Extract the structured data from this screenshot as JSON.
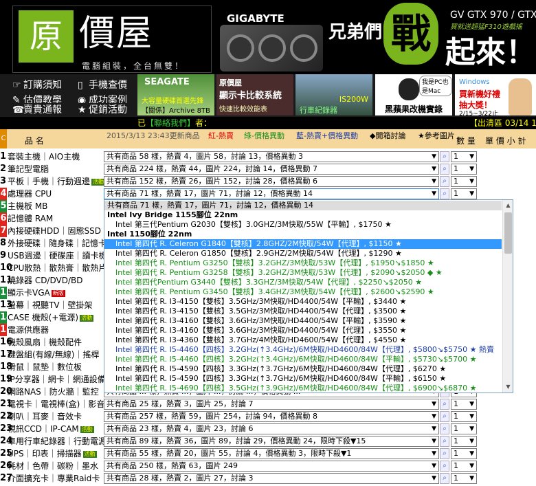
{
  "header": {
    "logo_char": "原",
    "logo_title": "價屋",
    "logo_slogan": "電腦組裝，全台無雙！",
    "ad": {
      "brand": "GIGABYTE",
      "slogan1": "兄弟們，",
      "slogan_war": "戰",
      "slogan2": "起來！",
      "product": "GV GTX 970 / GTX 9",
      "note": "買就送超猛F310遊戲搖"
    }
  },
  "nav": {
    "order_notice": "訂購須知",
    "mobile_lookup": "手機查價",
    "estimate_guide": "估價教學",
    "success_cases": "成功案例",
    "report": "賣貴通報",
    "promotions": "促銷活動"
  },
  "banners": {
    "seagate": {
      "brand": "SEAGATE",
      "line2": "大容量硬碟首選先鋒",
      "line3": "【關係】Archive 8TB HDD"
    },
    "compare": {
      "line1": "原價屋",
      "line2": "顯示卡比較系統",
      "line3": "快速比較效能表"
    },
    "dashcam": {
      "line1": "IS200W",
      "line2": "行車紀錄器"
    },
    "mac": {
      "line1": "我是PC也是Mac",
      "line2": "黑蘋果改機實錄"
    },
    "windows": {
      "line1": "Windows",
      "line2": "買新機好禮",
      "line3": "抽大獎！",
      "line4": "2/15~3/22止"
    }
  },
  "strip": {
    "prefix": "已",
    "link": "【聯絡我們】",
    "suffix": "者：",
    "promo": "【出清區 03/14 13"
  },
  "table_header": {
    "c": "C",
    "name": "品 名",
    "timestamp": "2015/3/13 23:43更新商品",
    "legend_hot": "紅-熱賣",
    "legend_change": "綠-價格異動",
    "legend_blue": "藍-熱賣+價格異動",
    "legend_open": "◆開箱討論",
    "legend_ref": "★參考圖片",
    "qty": "數 量",
    "price": "單 價 小 計"
  },
  "rows": [
    {
      "num": "1",
      "cat": "套裝主機｜AIO主機",
      "summary": "共有商品 58 樣，熱賣 4，圖片 58，討論 13，價格異動 3",
      "qty": "1"
    },
    {
      "num": "2",
      "cat": "筆記型電腦",
      "summary": "共有商品 224 樣，熱賣 44，圖片 224，討論 14，價格異動 7",
      "qty": "1"
    },
    {
      "num": "3",
      "cat": "平板｜手機｜行動週邊",
      "badge": "活動",
      "summary": "共有商品 152 樣，熱賣 26，圖片 152，討論 28，價格異動 6",
      "qty": "1"
    },
    {
      "num": "4",
      "cat": "處理器 CPU",
      "summary": "共有商品 71 樣，熱賣 17，圖片 71，討論 12，價格異動 14",
      "qty": "1"
    },
    {
      "num": "5",
      "cat": "主機板 MB",
      "summary": "",
      "qty": ""
    },
    {
      "num": "6",
      "cat": "記憶體 RAM",
      "summary": "",
      "qty": ""
    },
    {
      "num": "7",
      "cat": "內接硬碟HDD｜固態SSD",
      "summary": "",
      "qty": ""
    },
    {
      "num": "8",
      "cat": "外接硬碟｜隨身碟｜記憶卡",
      "summary": "",
      "qty": ""
    },
    {
      "num": "9",
      "cat": "USB週邊｜硬碟座｜讀卡機",
      "summary": "",
      "qty": ""
    },
    {
      "num": "10",
      "cat": "CPU散熱｜散熱膏｜散熱片",
      "summary": "",
      "qty": ""
    },
    {
      "num": "11",
      "cat": "燒錄器 CD/DVD/BD",
      "summary": "",
      "qty": ""
    },
    {
      "num": "12",
      "cat": "顯示卡VGA",
      "badge_new": "新版",
      "summary": "",
      "qty": ""
    },
    {
      "num": "13",
      "cat": "螢幕｜視聽TV｜壁掛架",
      "summary": "",
      "qty": ""
    },
    {
      "num": "14",
      "cat": "CASE 機殼(+電源)",
      "badge": "活動",
      "summary": "",
      "qty": ""
    },
    {
      "num": "15",
      "cat": "電源供應器",
      "summary": "",
      "qty": ""
    },
    {
      "num": "16",
      "cat": "機殼風扇｜機殼配件",
      "summary": "",
      "qty": ""
    },
    {
      "num": "17",
      "cat": "鍵盤組(有線/無線)｜搖桿",
      "summary": "",
      "qty": ""
    },
    {
      "num": "18",
      "cat": "滑鼠｜鼠墊｜數位板",
      "summary": "",
      "qty": ""
    },
    {
      "num": "19",
      "cat": "IP分享器｜網卡｜網通設備",
      "summary": "",
      "qty": ""
    },
    {
      "num": "20",
      "cat": "網路NAS｜防火牆｜監控",
      "summary": "共有商品 ... 樣，熱賣 ...，圖片 ...，討論 ...，價格異動 ...",
      "qty": "1"
    },
    {
      "num": "21",
      "cat": "電視卡｜電視棒(盒)｜影音",
      "summary": "共有商品 25 樣，熱賣 3，圖片 25，討論 7",
      "qty": "1"
    },
    {
      "num": "22",
      "cat": "喇叭｜耳麥｜音效卡",
      "summary": "共有商品 257 樣，熱賣 59，圖片 254，討論 94，價格異動 8",
      "qty": "1"
    },
    {
      "num": "23",
      "cat": "視訊CCD｜IP-CAM",
      "badge": "活動",
      "summary": "共有商品 23 樣，熱賣 4，圖片 23，討論 6",
      "qty": "1"
    },
    {
      "num": "24",
      "cat": "車用行車紀錄器｜行動電源",
      "summary": "共有商品 89 樣，熱賣 36，圖片 89，討論 29，價格異動 24，限時下殺▼15",
      "qty": "1"
    },
    {
      "num": "25",
      "cat": "UPS｜印表｜掃描器",
      "badge": "活動",
      "summary": "共有商品 55 樣，熱賣 20，圖片 55，討論 4，價格異動 3，限時下殺▼1",
      "qty": "1"
    },
    {
      "num": "26",
      "cat": "耗材｜色帶｜碳粉｜墨水",
      "summary": "共有商品 250 樣，熱賣 63，圖片 249",
      "qty": "1"
    },
    {
      "num": "27",
      "cat": "介面擴充卡｜專業Raid卡",
      "summary": "共有商品 28 樣，熱賣 2，圖片 27，討論 3",
      "qty": "1"
    }
  ],
  "dropdown": {
    "options": [
      {
        "text": "共有商品 71 樣，熱賣 17，圖片 71，討論 12，價格異動 14",
        "kind": "first"
      },
      {
        "text": "Intel Ivy Bridge 1155腳位 22nm",
        "kind": "hdr"
      },
      {
        "text": "Intel 第三代Pentium G2030【雙核】3.0GHZ/3M快取/55W【平輸】, $1750 ★",
        "kind": "c-black"
      },
      {
        "text": "Intel 1150腳位 22nm",
        "kind": "hdr"
      },
      {
        "text": "Intel 第四代 R. Celeron G1840【雙核】2.8GHZ/2M快取/54W【代理】, $1150 ★",
        "kind": "sel"
      },
      {
        "text": "Intel 第四代 R. Celeron G1850【雙核】2.9GHZ/2M快取/54W【代理】, $1290 ★",
        "kind": "c-black"
      },
      {
        "text": "Intel 第四代 R. Pentium G3250【雙核】3.2GHZ/3M快取/53W【代理】, $1950↘$1850 ★",
        "kind": "c-green"
      },
      {
        "text": "Intel 第四代 R. Pentium G3258【雙核】3.2GHZ/3M快取/53W【代理】, $2090↘$2050 ◆ ★",
        "kind": "c-green"
      },
      {
        "text": "Intel 第四代Pentium G3440【雙核】3.3GHZ/3M快取/54W【代理】, $2250↘$2050 ★",
        "kind": "c-green"
      },
      {
        "text": "Intel 第四代 R. Pentium G3450【雙核】3.4GHZ/3M快取/54W【代理】, $2600↘$2590 ★",
        "kind": "c-green"
      },
      {
        "text": "Intel 第四代 R. I3-4150【雙核】3.5GHz/3M快取/HD4400/54W【平輸】, $3440 ★",
        "kind": "c-black"
      },
      {
        "text": "Intel 第四代 R. I3-4150【雙核】3.5GHz/3M快取/HD4400/54W【代理】, $3500 ★",
        "kind": "c-black"
      },
      {
        "text": "Intel 第四代 R. I3-4160【雙核】3.6GHz/3M快取/HD4400/54W【平輸】, $3590 ★",
        "kind": "c-black"
      },
      {
        "text": "Intel 第四代 R. I3-4160【雙核】3.6GHz/3M快取/HD4400/54W【代理】, $3550 ★",
        "kind": "c-black"
      },
      {
        "text": "Intel 第四代 R. I3-4360【雙核】3.7GHz/4M快取/HD4600/54W【代理】, $4550 ★",
        "kind": "c-black"
      },
      {
        "text": "Intel 第四代 R. I5-4460【四核】3.2GHz(↑3.4GHz)/6M快取/HD4600/84W【代理】, $5800↘$5750 ★ 熱賣",
        "kind": "c-blue"
      },
      {
        "text": "Intel 第四代 R. I5-4460【四核】3.2GHz(↑3.4GHz)/6M快取/HD4600/84W【平輸】, $5730↘$5700 ★",
        "kind": "c-green"
      },
      {
        "text": "Intel 第四代 R. I5-4590【四核】3.3GHz(↑3.7GHz)/6M快取/HD4600/84W【代理】, $6270 ★",
        "kind": "c-black"
      },
      {
        "text": "Intel 第四代 R. I5-4590【四核】3.3GHz(↑3.7GHz)/6M快取/HD4600/84W【平輸】, $6150 ★",
        "kind": "c-black"
      },
      {
        "text": "Intel 第四代 R. I5-4690【四核】3.5GHz(↑3.9GHz)/6M快取/HD4600/84W【代理】, $6900↘$6870 ★",
        "kind": "c-green"
      }
    ]
  },
  "colors": {
    "accent_green": "#7ab51d",
    "hot_red": "#e0261e",
    "selected_blue": "#3399ff",
    "header_band": "#f5d79c"
  }
}
